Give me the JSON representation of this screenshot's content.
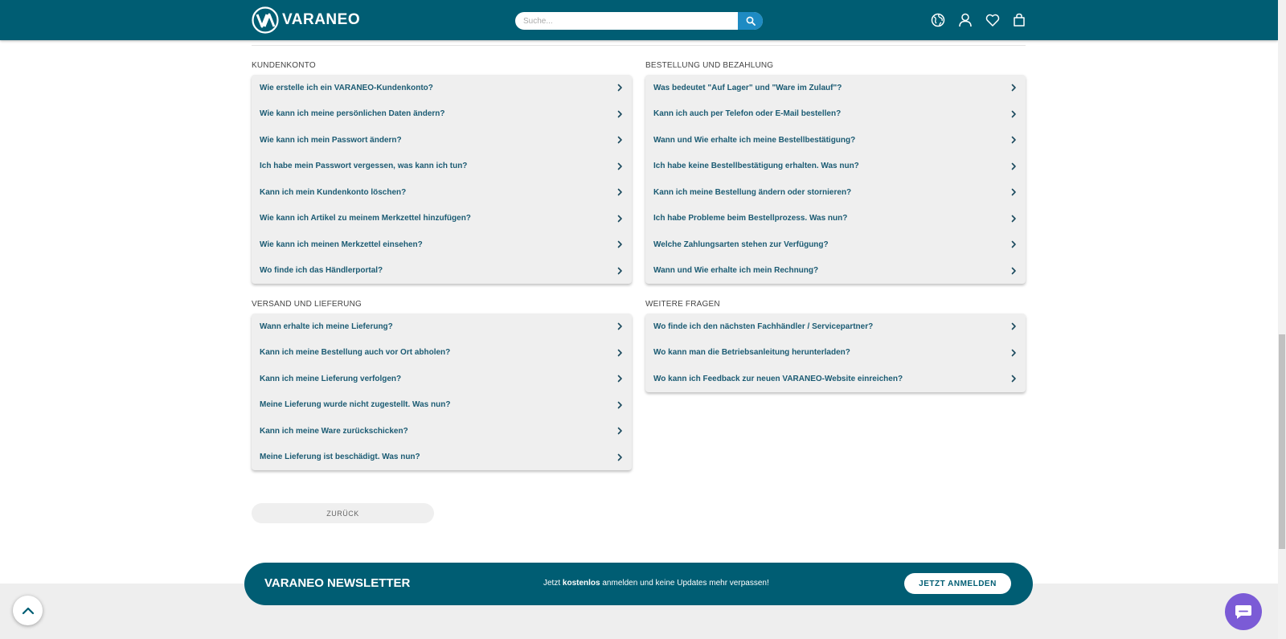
{
  "header": {
    "logo_text": "VARANEO",
    "search_placeholder": "Suche...",
    "icons": [
      "globe-icon",
      "user-icon",
      "heart-icon",
      "bag-icon"
    ]
  },
  "sections": {
    "kundenkonto": {
      "title": "KUNDENKONTO",
      "items": [
        "Wie erstelle ich ein VARANEO-Kundenkonto?",
        "Wie kann ich meine persönlichen Daten ändern?",
        "Wie kann ich mein Passwort ändern?",
        "Ich habe mein Passwort vergessen, was kann ich tun?",
        "Kann ich mein Kundenkonto löschen?",
        "Wie kann ich Artikel zu meinem Merkzettel hinzufügen?",
        "Wie kann ich meinen Merkzettel einsehen?",
        "Wo finde ich das Händlerportal?"
      ]
    },
    "bestellung": {
      "title": "BESTELLUNG UND BEZAHLUNG",
      "items": [
        "Was bedeutet \"Auf Lager\" und \"Ware im Zulauf\"?",
        "Kann ich auch per Telefon oder E-Mail bestellen?",
        "Wann und Wie erhalte ich meine Bestellbestätigung?",
        "Ich habe keine Bestellbestätigung erhalten. Was nun?",
        "Kann ich meine Bestellung ändern oder stornieren?",
        "Ich habe Probleme beim Bestellprozess. Was nun?",
        "Welche Zahlungsarten stehen zur Verfügung?",
        "Wann und Wie erhalte ich mein Rechnung?"
      ]
    },
    "versand": {
      "title": "VERSAND UND LIEFERUNG",
      "items": [
        "Wann erhalte ich meine Lieferung?",
        "Kann ich meine Bestellung auch vor Ort abholen?",
        "Kann ich meine Lieferung verfolgen?",
        "Meine Lieferung wurde nicht zugestellt. Was nun?",
        "Kann ich meine Ware zurückschicken?",
        "Meine Lieferung ist beschädigt. Was nun?"
      ]
    },
    "weitere": {
      "title": "WEITERE FRAGEN",
      "items": [
        "Wo finde ich den nächsten Fachhändler / Servicepartner?",
        "Wo kann man die Betriebsanleitung herunterladen?",
        "Wo kann ich Feedback zur neuen VARANEO-Website einreichen?"
      ]
    }
  },
  "back_button": "ZURÜCK",
  "newsletter": {
    "title": "VARANEO NEWSLETTER",
    "text_before": "Jetzt ",
    "text_bold": "kostenlos",
    "text_after": " anmelden und keine Updates mehr verpassen!",
    "button": "JETZT ANMELDEN"
  },
  "colors": {
    "brand": "#005d73",
    "link": "#1b5b73",
    "search_button": "#1e8bc3",
    "chat": "#7b5bd6"
  }
}
